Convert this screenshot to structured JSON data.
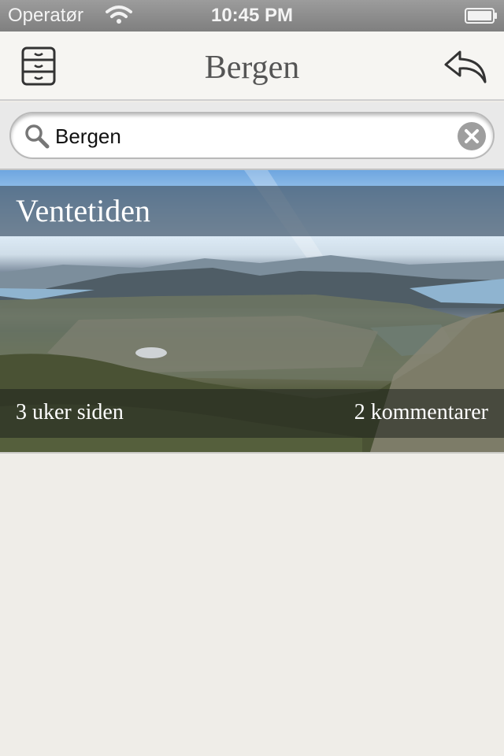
{
  "status_bar": {
    "carrier": "Operatør",
    "time": "10:45 PM",
    "icons": [
      "wifi-icon",
      "battery-icon"
    ]
  },
  "nav": {
    "title": "Bergen",
    "left_icon": "archive-drawer-icon",
    "right_icon": "reply-arrow-icon"
  },
  "search": {
    "value": "Bergen",
    "placeholder": "",
    "icon": "search-icon",
    "clear_icon": "clear-icon"
  },
  "posts": [
    {
      "title": "Ventetiden",
      "time_ago": "3 uker siden",
      "comments": "2 kommentarer"
    }
  ],
  "colors": {
    "status_bar": "#8c8c8c",
    "nav_bar": "#f6f5f2",
    "background": "#efede8",
    "title_text": "#555555"
  }
}
